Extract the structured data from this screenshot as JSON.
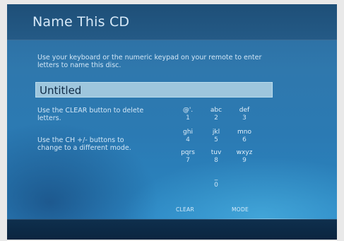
{
  "dialog": {
    "title": "Name This CD",
    "instructions": "Use your keyboard or the numeric keypad on your remote to enter letters to name this disc.",
    "name_value": "Untitled",
    "help_clear": "Use the CLEAR button to delete letters.",
    "help_mode": "Use the CH +/- buttons to change to a different mode."
  },
  "keypad": {
    "keys": [
      {
        "letters": "@'.",
        "digit": "1"
      },
      {
        "letters": "abc",
        "digit": "2"
      },
      {
        "letters": "def",
        "digit": "3"
      },
      {
        "letters": "ghi",
        "digit": "4"
      },
      {
        "letters": "jkl",
        "digit": "5"
      },
      {
        "letters": "mno",
        "digit": "6"
      },
      {
        "letters": "pqrs",
        "digit": "7"
      },
      {
        "letters": "tuv",
        "digit": "8"
      },
      {
        "letters": "wxyz",
        "digit": "9"
      },
      {
        "letters": "_",
        "digit": "0"
      }
    ],
    "clear_label": "CLEAR",
    "mode_label": "MODE"
  }
}
